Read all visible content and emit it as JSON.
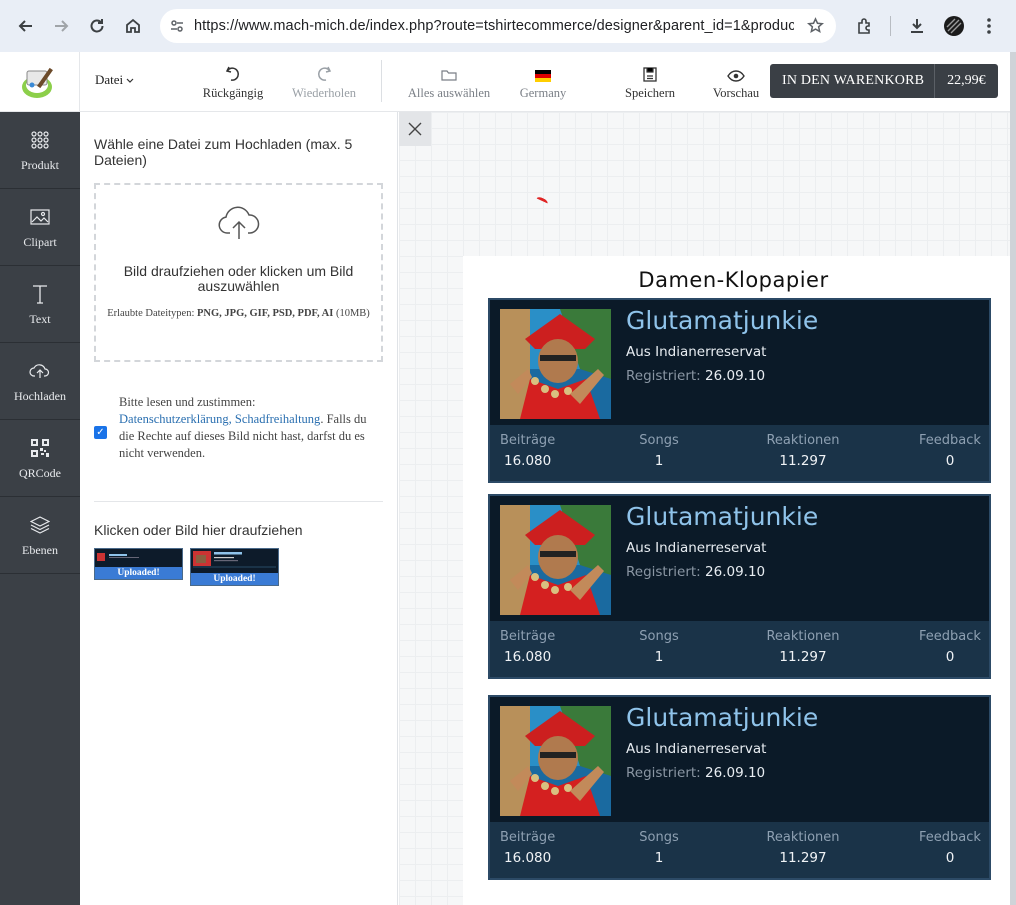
{
  "browser": {
    "url": "https://www.mach-mich.de/index.php?route=tshirtecommerce/designer&parent_id=1&produc..."
  },
  "toolbar": {
    "file_menu": "Datei",
    "undo": "Rückgängig",
    "redo": "Wiederholen",
    "select_all": "Alles auswählen",
    "language": "Germany",
    "save": "Speichern",
    "preview": "Vorschau",
    "cart_label": "IN DEN WARENKORB",
    "cart_price": "22,99€"
  },
  "sidebar": {
    "items": [
      {
        "label": "Produkt",
        "icon": "grid-dots-icon"
      },
      {
        "label": "Clipart",
        "icon": "image-icon"
      },
      {
        "label": "Text",
        "icon": "text-icon"
      },
      {
        "label": "Hochladen",
        "icon": "cloud-upload-icon"
      },
      {
        "label": "QRCode",
        "icon": "qrcode-icon"
      },
      {
        "label": "Ebenen",
        "icon": "layers-icon"
      }
    ]
  },
  "upload": {
    "title": "Wähle eine Datei zum Hochladen (max. 5 Dateien)",
    "drop_text": "Bild draufziehen oder klicken um Bild auszuwählen",
    "allowed_prefix": "Erlaubte Dateitypen:",
    "allowed_types": "PNG, JPG, GIF, PSD, PDF, AI",
    "allowed_size": "(10MB)",
    "consent_prefix": "Bitte lesen und zustimmen:",
    "consent_link": "Datenschutzerklärung, Schadfreihaltung",
    "consent_suffix": ". Falls du die Rechte auf dieses Bild nicht hast, darfst du es nicht verwenden.",
    "click_text": "Klicken oder Bild hier draufziehen",
    "uploaded_label": "Uploaded!"
  },
  "canvas": {
    "product_title": "Damen-Klopapier"
  },
  "profile_card": {
    "name": "Glutamatjunkie",
    "origin": "Aus Indianerreservat",
    "registered_label": "Registriert:",
    "registered_date": "26.09.10",
    "stats": [
      {
        "label": "Beiträge",
        "value": "16.080"
      },
      {
        "label": "Songs",
        "value": "1"
      },
      {
        "label": "Reaktionen",
        "value": "11.297"
      },
      {
        "label": "Feedback",
        "value": "0"
      }
    ]
  },
  "colors": {
    "card_bg": "#0b1a28",
    "card_name": "#8fc3ea",
    "stats_bg": "#1a3348",
    "sidebar_bg": "#3b4046",
    "cart_bg": "#3a3f45",
    "link": "#2a6fb0",
    "checkbox": "#1a73e8"
  }
}
